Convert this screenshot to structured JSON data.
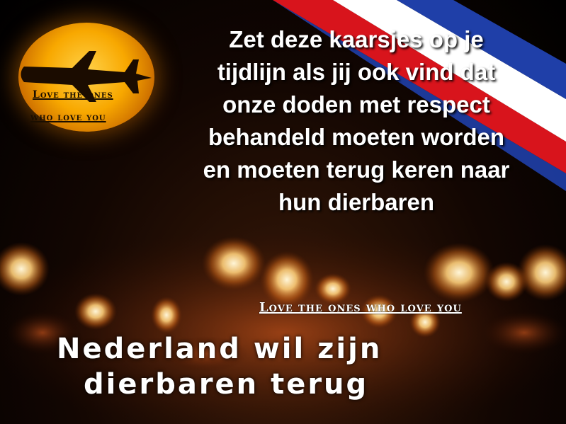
{
  "image": {
    "message_lines": [
      "Zet deze kaarsjes op je",
      "tijdlijn als jij ook vind dat",
      "onze doden met respect",
      "behandeld moeten worden",
      "en moeten terug keren naar",
      "hun dierbaren"
    ],
    "tagline_small_1": "Love the ones",
    "tagline_small_2": "who love you",
    "tagline_wide": "Love the ones who love you",
    "headline_line1": "Nederland wil zijn",
    "headline_line2": "dierbaren terug",
    "icons": [
      "airplane-icon",
      "sun-icon",
      "dutch-flag-ribbon",
      "candle-lights"
    ],
    "colors": {
      "flag_red": "#d8141c",
      "flag_white": "#ffffff",
      "flag_blue": "#1f3fa8",
      "sun": "#f8a800"
    }
  }
}
